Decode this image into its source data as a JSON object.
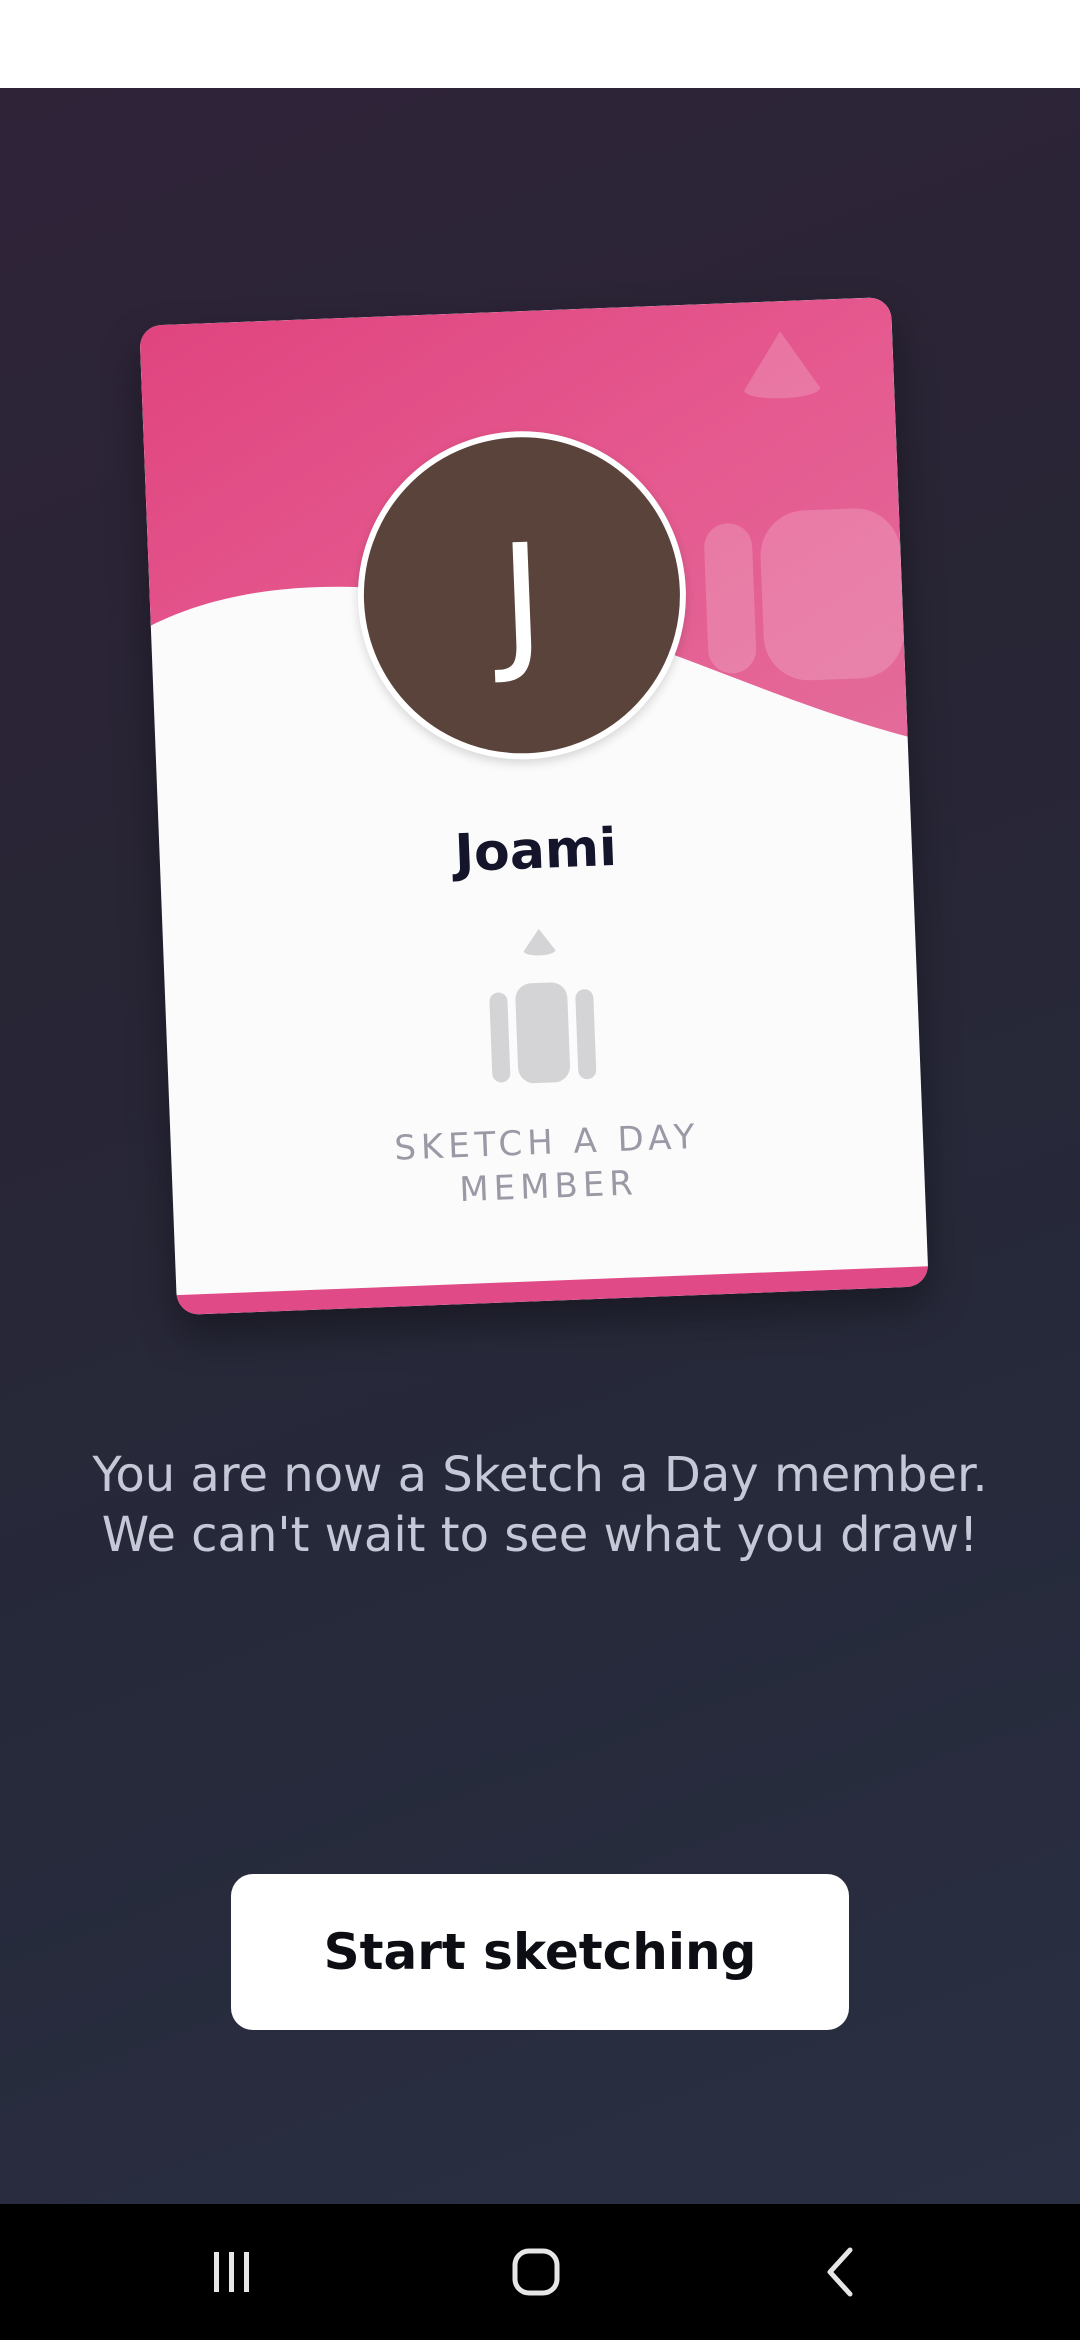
{
  "card": {
    "initial": "J",
    "name": "Joami",
    "label_line1": "SKETCH A DAY",
    "label_line2": "MEMBER"
  },
  "message": {
    "line1": "You are now a Sketch a Day member.",
    "line2": "We can't wait to see what you draw!"
  },
  "cta": {
    "label": "Start sketching"
  },
  "nav": {
    "recent_icon": "recent-apps-icon",
    "home_icon": "home-icon",
    "back_icon": "back-icon"
  },
  "colors": {
    "card_accent": "#e04a86",
    "avatar_bg": "#5a433a",
    "background_dark": "#272838",
    "message_text": "#c5c8d6"
  }
}
